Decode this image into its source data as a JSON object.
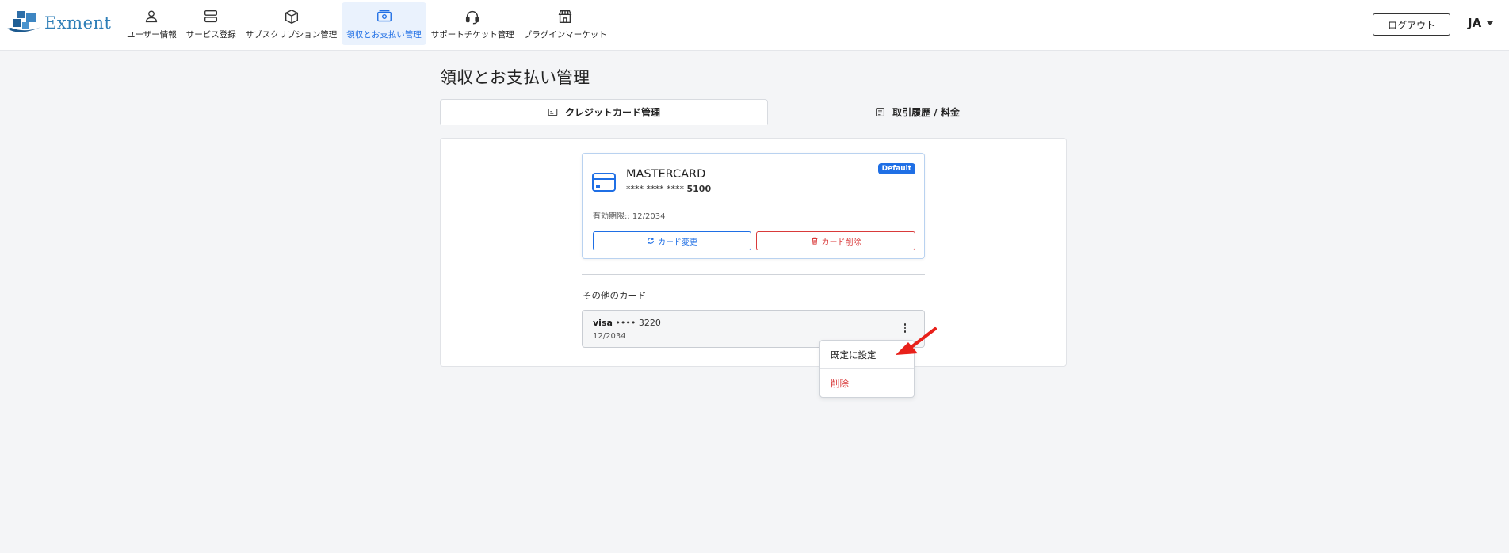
{
  "header": {
    "logo_text": "Exment",
    "nav": [
      {
        "label": "ユーザー情報",
        "icon": "user-icon"
      },
      {
        "label": "サービス登録",
        "icon": "server-icon"
      },
      {
        "label": "サブスクリプション管理",
        "icon": "box-icon"
      },
      {
        "label": "領収とお支払い管理",
        "icon": "money-icon",
        "active": true
      },
      {
        "label": "サポートチケット管理",
        "icon": "headset-icon"
      },
      {
        "label": "プラグインマーケット",
        "icon": "store-icon"
      }
    ],
    "logout_label": "ログアウト",
    "language": "JA"
  },
  "page": {
    "title": "領収とお支払い管理",
    "tabs": [
      {
        "label": "クレジットカード管理",
        "active": true
      },
      {
        "label": "取引履歴 / 料金"
      }
    ]
  },
  "default_card": {
    "brand": "MASTERCARD",
    "masked_prefix": "**** **** ****",
    "last4": "5100",
    "badge": "Default",
    "expiry": "有効期限:: 12/2034",
    "change_label": "カード変更",
    "delete_label": "カード削除"
  },
  "other_cards": {
    "title": "その他のカード",
    "items": [
      {
        "brand": "visa",
        "masked": "•••• 3220",
        "expiry": "12/2034"
      }
    ]
  },
  "dropdown": {
    "set_default_label": "既定に設定",
    "delete_label": "削除"
  },
  "colors": {
    "accent": "#1f6fe5",
    "danger": "#d93a3a",
    "arrow": "#e8201a"
  }
}
